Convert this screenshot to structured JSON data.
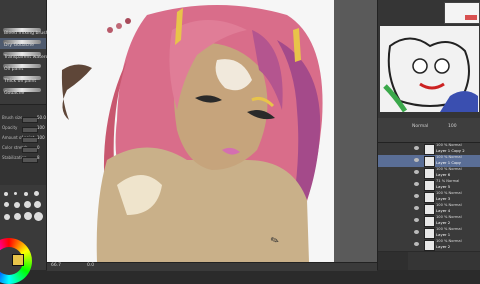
{
  "brushes": [
    {
      "label": "Bleed mixing brush"
    },
    {
      "label": "Dry Gouache"
    },
    {
      "label": "Transparent watercolor"
    },
    {
      "label": "Oil paint"
    },
    {
      "label": "Thick oil paint"
    },
    {
      "label": "Gouache"
    }
  ],
  "tool_properties": [
    {
      "label": "Brush size",
      "value": "50.0"
    },
    {
      "label": "Opacity",
      "value": "100"
    },
    {
      "label": "Amount of paint",
      "value": "100"
    },
    {
      "label": "Color stretch",
      "value": "0"
    },
    {
      "label": "Stabilization",
      "value": "8"
    }
  ],
  "status": {
    "zoom": "66.7",
    "angle": "0.0"
  },
  "layers": [
    {
      "opacity_mode": "100 % Normal",
      "name": "Layer 1 Copy 2"
    },
    {
      "opacity_mode": "100 % Normal",
      "name": "Layer 1 Copy"
    },
    {
      "opacity_mode": "100 % Normal",
      "name": "Layer 6"
    },
    {
      "opacity_mode": "71 % Normal",
      "name": "Layer 5"
    },
    {
      "opacity_mode": "100 % Normal",
      "name": "Layer 3"
    },
    {
      "opacity_mode": "100 % Normal",
      "name": "Layer 4"
    },
    {
      "opacity_mode": "100 % Normal",
      "name": "Layer 2"
    },
    {
      "opacity_mode": "100 % Normal",
      "name": "Layer 1"
    },
    {
      "opacity_mode": "100 % Normal",
      "name": "Layer 2"
    }
  ],
  "layer_header": {
    "blend": "Normal",
    "opacity": "100"
  },
  "colors": {
    "accent": "#5a6e96",
    "main_color": "#e8c44a"
  }
}
